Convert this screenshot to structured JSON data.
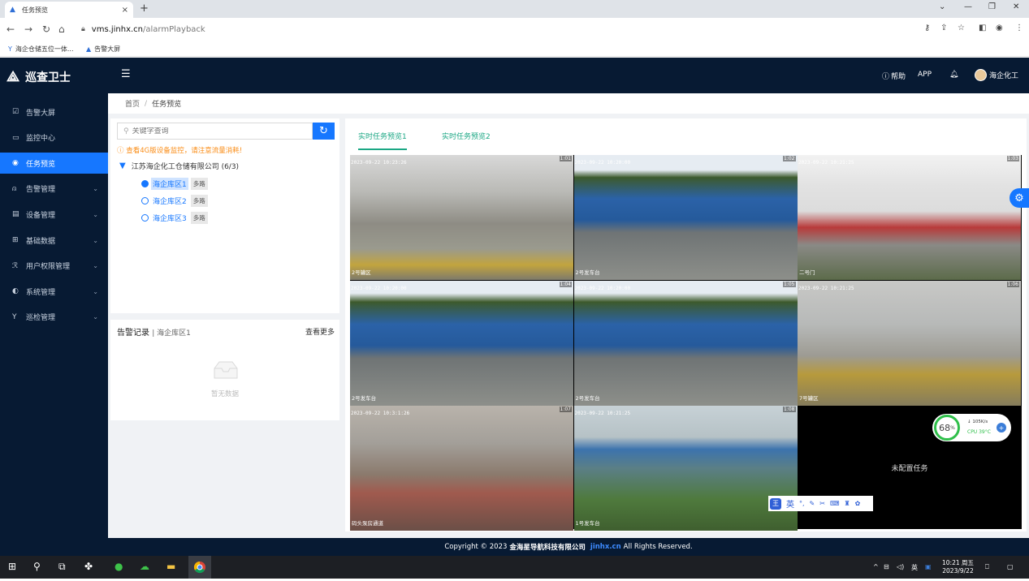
{
  "browser": {
    "tab_title": "任务预览",
    "tab_close": "×",
    "new_tab": "+",
    "url_host": "vms.jinhx.cn",
    "url_path": "/alarmPlayback",
    "bookmarks": [
      "海企仓储五位一体...",
      "告警大屏"
    ]
  },
  "header": {
    "logo_text": "巡查卫士",
    "help_label": "帮助",
    "app_label": "APP",
    "user_name": "海企化工"
  },
  "sidebar": {
    "items": [
      {
        "label": "告警大屏",
        "icon": "monitor-icon",
        "glyph": "☑",
        "arrow": ""
      },
      {
        "label": "监控中心",
        "icon": "camera-icon",
        "glyph": "▭",
        "arrow": ""
      },
      {
        "label": "任务预览",
        "icon": "preview-icon",
        "glyph": "◉",
        "arrow": ""
      },
      {
        "label": "告警管理",
        "icon": "bell-icon",
        "glyph": "⍝",
        "arrow": "⌄"
      },
      {
        "label": "设备管理",
        "icon": "device-icon",
        "glyph": "▤",
        "arrow": "⌄"
      },
      {
        "label": "基础数据",
        "icon": "grid-icon",
        "glyph": "⊞",
        "arrow": "⌄"
      },
      {
        "label": "用户权限管理",
        "icon": "user-icon",
        "glyph": "ℛ",
        "arrow": "⌄"
      },
      {
        "label": "系统管理",
        "icon": "system-icon",
        "glyph": "◐",
        "arrow": "⌄"
      },
      {
        "label": "巡检管理",
        "icon": "patrol-icon",
        "glyph": "Y",
        "arrow": "⌄"
      }
    ],
    "active_index": 2
  },
  "breadcrumb": {
    "home": "首页",
    "current": "任务预览"
  },
  "tree": {
    "search_placeholder": "关键字查询",
    "warning": "查看4G版设备监控，请注意流量消耗!",
    "root_label": "江苏海企化工仓储有限公司 (6/3)",
    "nodes": [
      {
        "label": "海企库区1",
        "tag": "多路"
      },
      {
        "label": "海企库区2",
        "tag": "多路"
      },
      {
        "label": "海企库区3",
        "tag": "多路"
      }
    ]
  },
  "alarm": {
    "title": "告警记录",
    "subtitle": "| 海企库区1",
    "more": "查看更多",
    "empty": "暂无数据"
  },
  "video": {
    "tabs": [
      "实时任务预览1",
      "实时任务预览2"
    ],
    "cameras": [
      {
        "ts": "2023-09-22 10:23:26",
        "name": "2号罐区",
        "idx": "1:01"
      },
      {
        "ts": "2023-09-22 10:20:00",
        "name": "2号发车台",
        "idx": "1:02"
      },
      {
        "ts": "2023-09-22 10:21:25",
        "name": "二号门",
        "idx": "1:03"
      },
      {
        "ts": "2023-09-22 10:20:00",
        "name": "2号发车台",
        "idx": "1:04"
      },
      {
        "ts": "2023-09-22 10:20:00",
        "name": "2号发车台",
        "idx": "1:05"
      },
      {
        "ts": "2023-09-22 10:21:25",
        "name": "7号罐区",
        "idx": "1:06"
      },
      {
        "ts": "2023-09-22 10:3:1:26",
        "name": "码头泵房通道",
        "idx": "1:07"
      },
      {
        "ts": "2023-09-22 10:21:25",
        "name": "1号发车台",
        "idx": "1:08"
      }
    ],
    "unconfigured": "未配置任务"
  },
  "footer": {
    "prefix": "Copyright © 2023",
    "company": "金海星导航科技有限公司",
    "link": "jinhx.cn",
    "suffix": "All Rights Reserved."
  },
  "cpu_widget": {
    "percent": "68",
    "unit": "%",
    "net": "105K/s",
    "temp": "CPU 39°C"
  },
  "ime": {
    "mode": "英"
  },
  "taskbar": {
    "time": "10:21 周五",
    "date": "2023/9/22",
    "tray_lang": "英"
  },
  "colors": {
    "accent": "#1677ff",
    "dark": "#071a33",
    "green": "#1ba784",
    "warning": "#fa8c16"
  }
}
